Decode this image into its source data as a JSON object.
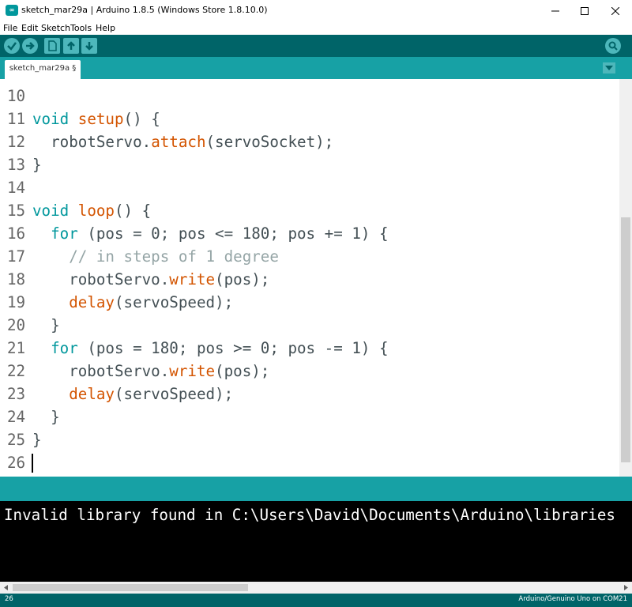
{
  "window": {
    "title": "sketch_mar29a | Arduino 1.8.5 (Windows Store 1.8.10.0)",
    "app_icon_text": "∞"
  },
  "menu": [
    "File",
    "Edit",
    "Sketch",
    "Tools",
    "Help"
  ],
  "tab": {
    "label": "sketch_mar29a §"
  },
  "editor": {
    "lines": [
      {
        "n": "10",
        "code": []
      },
      {
        "n": "11",
        "code": [
          [
            "kw",
            "void"
          ],
          [
            "",
            ""
          ],
          [
            "",
            ""
          ],
          [
            "fn",
            "setup"
          ],
          [
            "",
            "() {"
          ]
        ]
      },
      {
        "n": "12",
        "code": [
          [
            "",
            "  robotServo."
          ],
          [
            "fn",
            "attach"
          ],
          [
            "",
            "(servoSocket);"
          ]
        ]
      },
      {
        "n": "13",
        "code": [
          [
            "",
            "}"
          ]
        ]
      },
      {
        "n": "14",
        "code": []
      },
      {
        "n": "15",
        "code": [
          [
            "kw",
            "void"
          ],
          [
            "",
            ""
          ],
          [
            "",
            ""
          ],
          [
            "fn",
            "loop"
          ],
          [
            "",
            "() {"
          ]
        ]
      },
      {
        "n": "16",
        "code": [
          [
            "",
            "  "
          ],
          [
            "kw",
            "for"
          ],
          [
            "",
            " (pos = 0; pos <= 180; pos += 1) {"
          ]
        ]
      },
      {
        "n": "17",
        "code": [
          [
            "",
            "    "
          ],
          [
            "cm",
            "// in steps of 1 degree"
          ]
        ]
      },
      {
        "n": "18",
        "code": [
          [
            "",
            "    robotServo."
          ],
          [
            "fn",
            "write"
          ],
          [
            "",
            "(pos);"
          ]
        ]
      },
      {
        "n": "19",
        "code": [
          [
            "",
            "    "
          ],
          [
            "fn",
            "delay"
          ],
          [
            "",
            "(servoSpeed);"
          ]
        ]
      },
      {
        "n": "20",
        "code": [
          [
            "",
            "  }"
          ]
        ]
      },
      {
        "n": "21",
        "code": [
          [
            "",
            "  "
          ],
          [
            "kw",
            "for"
          ],
          [
            "",
            " (pos = 180; pos >= 0; pos -= 1) {"
          ]
        ]
      },
      {
        "n": "22",
        "code": [
          [
            "",
            "    robotServo."
          ],
          [
            "fn",
            "write"
          ],
          [
            "",
            "(pos);"
          ]
        ]
      },
      {
        "n": "23",
        "code": [
          [
            "",
            "    "
          ],
          [
            "fn",
            "delay"
          ],
          [
            "",
            "(servoSpeed);"
          ]
        ]
      },
      {
        "n": "24",
        "code": [
          [
            "",
            "  }"
          ]
        ]
      },
      {
        "n": "25",
        "code": [
          [
            "",
            "}"
          ]
        ]
      },
      {
        "n": "26",
        "code": []
      }
    ]
  },
  "console": {
    "text": "Invalid library found in C:\\Users\\David\\Documents\\Arduino\\libraries"
  },
  "footer": {
    "line": "26",
    "board": "Arduino/Genuino Uno on COM21"
  },
  "colors": {
    "toolbar": "#006468",
    "tabbar": "#17a1a5",
    "keyword": "#00979c",
    "function": "#d35400",
    "comment": "#95a5a6"
  }
}
